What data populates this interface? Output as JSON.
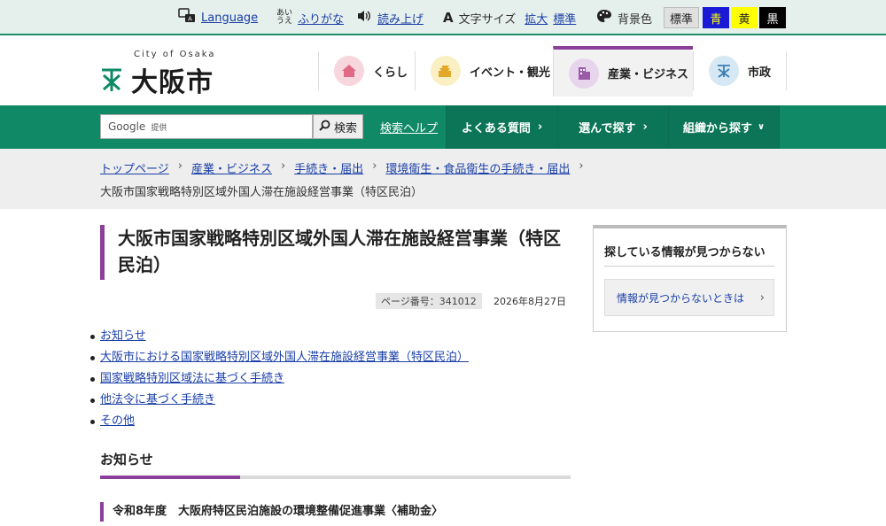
{
  "utility": {
    "language": "Language",
    "furigana": "ふりがな",
    "read_aloud": "読み上げ",
    "font_size_label": "文字サイズ",
    "font_size_large": "拡大",
    "font_size_standard": "標準",
    "bg_color_label": "背景色",
    "bg_standard": "標準",
    "bg_blue": "青",
    "bg_yellow": "黄",
    "bg_black": "黒"
  },
  "logo": {
    "en": "City of Osaka",
    "ja": "大阪市"
  },
  "global_nav": [
    {
      "label": "くらし",
      "icon": "house-icon",
      "color": "#f7d6dd"
    },
    {
      "label": "イベント・観光",
      "icon": "castle-icon",
      "color": "#fbefc4"
    },
    {
      "label": "産業・ビジネス",
      "icon": "building-icon",
      "color": "#e7d5ec"
    },
    {
      "label": "市政",
      "icon": "city-emblem-icon",
      "color": "#d6e8f3"
    }
  ],
  "search": {
    "placeholder_brand": "Google",
    "placeholder_sub": "提供",
    "button": "検索",
    "help": "検索ヘルプ"
  },
  "sub_nav": {
    "faq": "よくある質問",
    "choose": "選んで探す",
    "org": "組織から探す"
  },
  "breadcrumb": {
    "items": [
      "トップページ",
      "産業・ビジネス",
      "手続き・届出",
      "環境衛生・食品衛生の手続き・届出"
    ],
    "current": "大阪市国家戦略特別区域外国人滞在施設経営事業（特区民泊）"
  },
  "page": {
    "title": "大阪市国家戦略特別区域外国人滞在施設経営事業（特区民泊）",
    "page_number": "ページ番号：341012",
    "date": "2026年8月27日"
  },
  "toc": [
    "お知らせ",
    "大阪市における国家戦略特別区域外国人滞在施設経営事業（特区民泊）",
    "国家戦略特別区域法に基づく手続き",
    "他法令に基づく手続き",
    "その他"
  ],
  "section": {
    "heading": "お知らせ",
    "subheading": "令和8年度　大阪府特区民泊施設の環境整備促進事業〈補助金〉"
  },
  "sidebar": {
    "title": "探している情報が見つからない",
    "link": "情報が見つからないときは"
  },
  "colors": {
    "green": "#108a66",
    "accent": "#8b3f98"
  }
}
